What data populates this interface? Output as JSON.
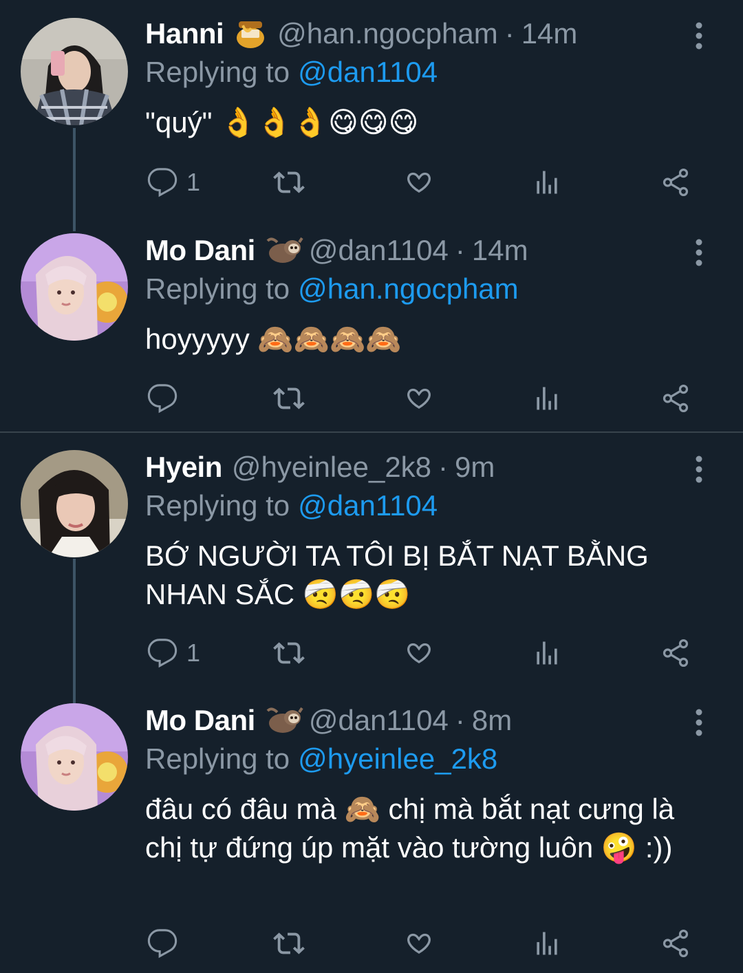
{
  "colors": {
    "background": "#15202b",
    "text_primary": "#ffffff",
    "text_secondary": "#8b98a5",
    "mention": "#1d9bf0",
    "thread_line": "#3d5466",
    "divider": "#38444d"
  },
  "replying_to_label": "Replying to",
  "tweets": [
    {
      "name": "Hanni",
      "badge": "honey-pot-emoji",
      "handle": "@han.ngocpham",
      "separator": "·",
      "time": "14m",
      "replying_to": "@dan1104",
      "text": "\"quý\" 👌👌👌😋😋😋",
      "reply_count": "1",
      "icons": [
        "reply-icon",
        "retweet-icon",
        "like-icon",
        "views-icon",
        "share-icon"
      ]
    },
    {
      "name": "Mo Dani",
      "badge": "sloth-emoji",
      "handle": "@dan1104",
      "separator": "·",
      "time": "14m",
      "replying_to": "@han.ngocpham",
      "text": "hoyyyyy 🙈🙈🙈🙈",
      "reply_count": "",
      "icons": [
        "reply-icon",
        "retweet-icon",
        "like-icon",
        "views-icon",
        "share-icon"
      ]
    },
    {
      "name": "Hyein",
      "badge": "",
      "handle": "@hyeinlee_2k8",
      "separator": "·",
      "time": "9m",
      "replying_to": "@dan1104",
      "text": "BỚ NGƯỜI TA TÔI BỊ BẮT NẠT BẰNG NHAN SẮC 🤕🤕🤕",
      "reply_count": "1",
      "icons": [
        "reply-icon",
        "retweet-icon",
        "like-icon",
        "views-icon",
        "share-icon"
      ]
    },
    {
      "name": "Mo Dani",
      "badge": "sloth-emoji",
      "handle": "@dan1104",
      "separator": "·",
      "time": "8m",
      "replying_to": "@hyeinlee_2k8",
      "text": "đâu có đâu mà 🙈 chị mà bắt nạt cưng là chị tự đứng úp mặt vào tường luôn 🤪 :))",
      "reply_count": "",
      "icons": [
        "reply-icon",
        "retweet-icon",
        "like-icon",
        "views-icon",
        "share-icon"
      ]
    }
  ]
}
